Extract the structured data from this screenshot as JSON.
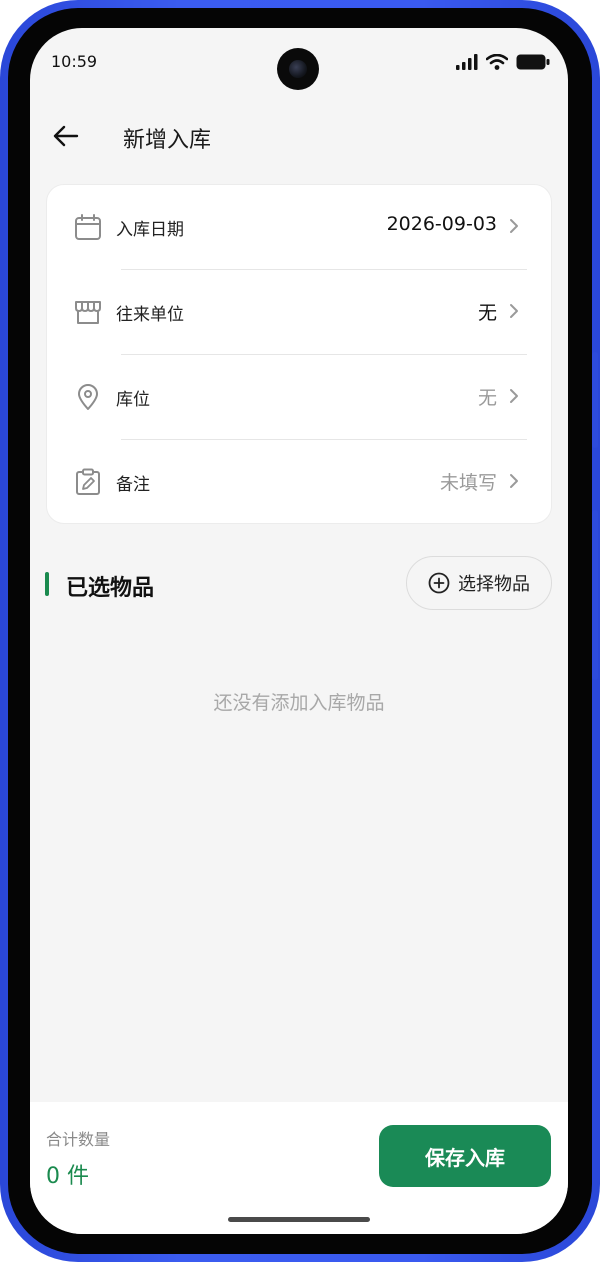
{
  "status_bar": {
    "time": "10:59"
  },
  "header": {
    "title": "新增入库",
    "back_icon": "arrow-left-icon"
  },
  "form": {
    "rows": [
      {
        "label": "入库日期",
        "value": "2026-09-03",
        "icon": "calendar-icon",
        "value_color": "#111111"
      },
      {
        "label": "往来单位",
        "value": "无",
        "icon": "store-icon",
        "value_color": "#111111"
      },
      {
        "label": "库位",
        "value": "无",
        "icon": "location-pin-icon",
        "value_color": "#9a9a9a"
      },
      {
        "label": "备注",
        "value": "未填写",
        "icon": "clipboard-edit-icon",
        "value_color": "#9a9a9a"
      }
    ]
  },
  "selected": {
    "title": "已选物品",
    "select_button": "选择物品",
    "empty_text": "还没有添加入库物品"
  },
  "footer": {
    "total_label": "合计数量",
    "total_value": "0 件",
    "save_button": "保存入库"
  },
  "colors": {
    "accent": "#1a8a56",
    "frame": "#3a5af0",
    "background": "#f5f5f5"
  }
}
